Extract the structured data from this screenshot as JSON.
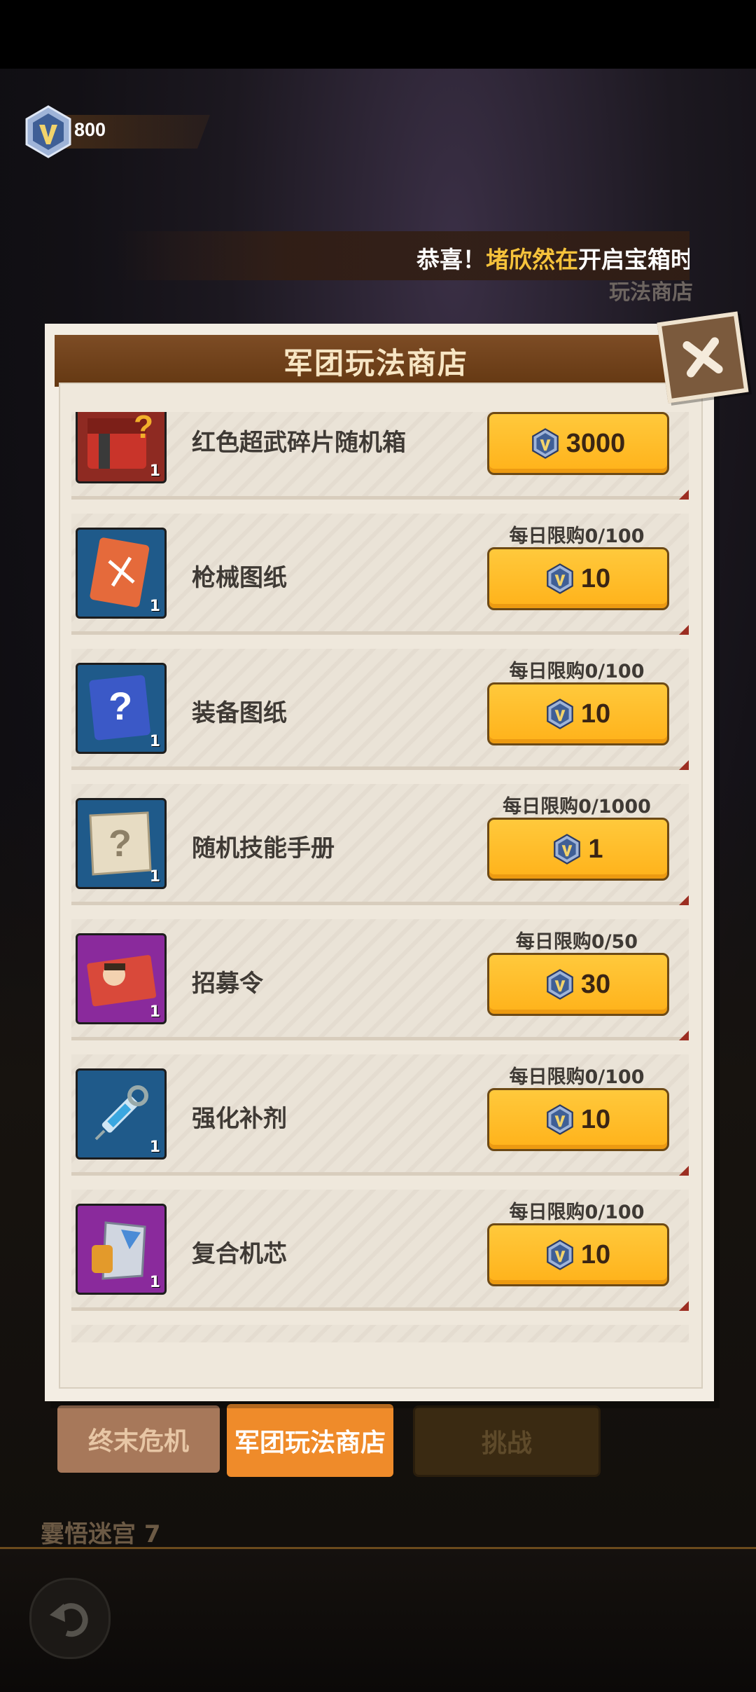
{
  "currency": {
    "icon": "crystal-badge-icon",
    "amount": "800"
  },
  "ticker": {
    "part1": "恭喜！",
    "part2": "堵欣然在",
    "part3": "开启宝箱",
    "part4": "时"
  },
  "background": {
    "store_label": "玩法商店",
    "tabs": [
      {
        "label": "终末危机"
      },
      {
        "label": "军团玩法商店"
      },
      {
        "label": "挑战"
      }
    ],
    "below_text": "霎悟迷宫  7"
  },
  "modal": {
    "title": "军团玩法商店",
    "close_icon": "close-x-icon"
  },
  "items": [
    {
      "name": "红色超武碎片随机箱",
      "limit": "",
      "price": "3000",
      "qty": "1",
      "icon": "red-chest-icon"
    },
    {
      "name": "枪械图纸",
      "limit": "每日限购0/100",
      "price": "10",
      "qty": "1",
      "icon": "weapon-blueprint-icon"
    },
    {
      "name": "装备图纸",
      "limit": "每日限购0/100",
      "price": "10",
      "qty": "1",
      "icon": "equipment-blueprint-icon"
    },
    {
      "name": "随机技能手册",
      "limit": "每日限购0/1000",
      "price": "1",
      "qty": "1",
      "icon": "skill-manual-icon"
    },
    {
      "name": "招募令",
      "limit": "每日限购0/50",
      "price": "30",
      "qty": "1",
      "icon": "recruit-order-icon"
    },
    {
      "name": "强化补剂",
      "limit": "每日限购0/100",
      "price": "10",
      "qty": "1",
      "icon": "syringe-icon"
    },
    {
      "name": "复合机芯",
      "limit": "每日限购0/100",
      "price": "10",
      "qty": "1",
      "icon": "composite-core-icon"
    }
  ],
  "colors": {
    "accent": "#ffb21a",
    "header": "#643812",
    "tab_active": "#ef8b2a"
  }
}
